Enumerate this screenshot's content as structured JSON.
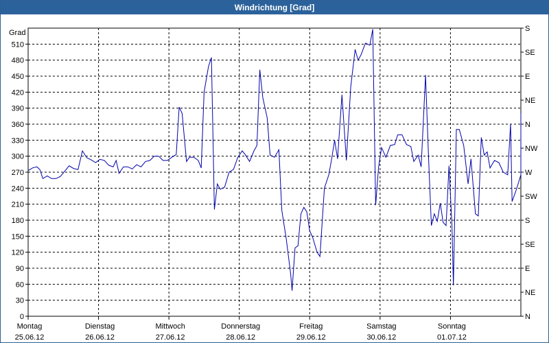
{
  "window": {
    "title": "Windrichtung [Grad]"
  },
  "chart_data": {
    "type": "line",
    "title": "Windrichtung [Grad]",
    "ylabel": "Grad",
    "ylim": [
      0,
      540
    ],
    "yticks": [
      0,
      30,
      60,
      90,
      120,
      150,
      180,
      210,
      240,
      270,
      300,
      330,
      360,
      390,
      420,
      450,
      480,
      510
    ],
    "right_axis": {
      "labels": [
        "N",
        "NE",
        "E",
        "SE",
        "S",
        "SW",
        "W",
        "NW",
        "N",
        "NE",
        "E",
        "SE",
        "S"
      ],
      "values": [
        0,
        45,
        90,
        135,
        180,
        225,
        270,
        315,
        360,
        405,
        450,
        495,
        540
      ]
    },
    "xlim": [
      "2012-06-25T00:00",
      "2012-07-02T00:00"
    ],
    "xticks": [
      {
        "day": "Montag",
        "date": "25.06.12",
        "x": "2012-06-25T00:00"
      },
      {
        "day": "Dienstag",
        "date": "26.06.12",
        "x": "2012-06-26T00:00"
      },
      {
        "day": "Mittwoch",
        "date": "27.06.12",
        "x": "2012-06-27T00:00"
      },
      {
        "day": "Donnerstag",
        "date": "28.06.12",
        "x": "2012-06-28T00:00"
      },
      {
        "day": "Freitag",
        "date": "29.06.12",
        "x": "2012-06-29T00:00"
      },
      {
        "day": "Samstag",
        "date": "30.06.12",
        "x": "2012-06-30T00:00"
      },
      {
        "day": "Sonntag",
        "date": "01.07.12",
        "x": "2012-07-01T00:00"
      }
    ],
    "grid": true,
    "line_color": "#0000aa",
    "series": [
      {
        "points": [
          [
            "2012-06-25T00:00",
            273
          ],
          [
            "2012-06-25T01:30",
            278
          ],
          [
            "2012-06-25T03:00",
            280
          ],
          [
            "2012-06-25T04:00",
            275
          ],
          [
            "2012-06-25T05:00",
            258
          ],
          [
            "2012-06-25T06:30",
            263
          ],
          [
            "2012-06-25T08:00",
            258
          ],
          [
            "2012-06-25T09:30",
            258
          ],
          [
            "2012-06-25T11:00",
            262
          ],
          [
            "2012-06-25T12:30",
            272
          ],
          [
            "2012-06-25T14:00",
            282
          ],
          [
            "2012-06-25T15:30",
            277
          ],
          [
            "2012-06-25T17:00",
            275
          ],
          [
            "2012-06-25T18:30",
            310
          ],
          [
            "2012-06-25T20:00",
            297
          ],
          [
            "2012-06-25T21:30",
            293
          ],
          [
            "2012-06-25T23:00",
            288
          ],
          [
            "2012-06-26T00:30",
            294
          ],
          [
            "2012-06-26T02:00",
            292
          ],
          [
            "2012-06-26T03:30",
            283
          ],
          [
            "2012-06-26T05:00",
            280
          ],
          [
            "2012-06-26T06:00",
            292
          ],
          [
            "2012-06-26T07:00",
            268
          ],
          [
            "2012-06-26T08:30",
            280
          ],
          [
            "2012-06-26T10:00",
            280
          ],
          [
            "2012-06-26T11:30",
            276
          ],
          [
            "2012-06-26T13:00",
            284
          ],
          [
            "2012-06-26T14:30",
            280
          ],
          [
            "2012-06-26T16:00",
            290
          ],
          [
            "2012-06-26T17:30",
            292
          ],
          [
            "2012-06-26T19:00",
            300
          ],
          [
            "2012-06-26T20:30",
            300
          ],
          [
            "2012-06-26T22:00",
            292
          ],
          [
            "2012-06-26T23:30",
            292
          ],
          [
            "2012-06-27T01:00",
            298
          ],
          [
            "2012-06-27T02:30",
            303
          ],
          [
            "2012-06-27T03:30",
            392
          ],
          [
            "2012-06-27T04:30",
            380
          ],
          [
            "2012-06-27T06:00",
            290
          ],
          [
            "2012-06-27T07:00",
            298
          ],
          [
            "2012-06-27T08:30",
            298
          ],
          [
            "2012-06-27T10:00",
            292
          ],
          [
            "2012-06-27T11:00",
            278
          ],
          [
            "2012-06-27T12:00",
            420
          ],
          [
            "2012-06-27T13:30",
            468
          ],
          [
            "2012-06-27T14:30",
            485
          ],
          [
            "2012-06-27T15:30",
            200
          ],
          [
            "2012-06-27T16:30",
            248
          ],
          [
            "2012-06-27T17:30",
            238
          ],
          [
            "2012-06-27T19:00",
            242
          ],
          [
            "2012-06-27T20:30",
            270
          ],
          [
            "2012-06-27T22:00",
            275
          ],
          [
            "2012-06-27T23:30",
            298
          ],
          [
            "2012-06-28T01:00",
            310
          ],
          [
            "2012-06-28T02:00",
            303
          ],
          [
            "2012-06-28T03:30",
            290
          ],
          [
            "2012-06-28T05:00",
            310
          ],
          [
            "2012-06-28T06:00",
            320
          ],
          [
            "2012-06-28T07:00",
            462
          ],
          [
            "2012-06-28T08:00",
            410
          ],
          [
            "2012-06-28T09:30",
            372
          ],
          [
            "2012-06-28T10:30",
            302
          ],
          [
            "2012-06-28T12:00",
            298
          ],
          [
            "2012-06-28T13:30",
            312
          ],
          [
            "2012-06-28T14:30",
            198
          ],
          [
            "2012-06-28T16:00",
            145
          ],
          [
            "2012-06-28T17:30",
            80
          ],
          [
            "2012-06-28T18:00",
            48
          ],
          [
            "2012-06-28T19:00",
            128
          ],
          [
            "2012-06-28T20:00",
            132
          ],
          [
            "2012-06-28T21:00",
            192
          ],
          [
            "2012-06-28T22:00",
            204
          ],
          [
            "2012-06-28T23:00",
            196
          ],
          [
            "2012-06-29T00:00",
            160
          ],
          [
            "2012-06-29T01:00",
            148
          ],
          [
            "2012-06-29T02:30",
            120
          ],
          [
            "2012-06-29T03:30",
            112
          ],
          [
            "2012-06-29T05:00",
            240
          ],
          [
            "2012-06-29T06:30",
            265
          ],
          [
            "2012-06-29T07:30",
            295
          ],
          [
            "2012-06-29T08:30",
            330
          ],
          [
            "2012-06-29T09:30",
            295
          ],
          [
            "2012-06-29T11:00",
            415
          ],
          [
            "2012-06-29T12:30",
            292
          ],
          [
            "2012-06-29T14:00",
            430
          ],
          [
            "2012-06-29T15:30",
            500
          ],
          [
            "2012-06-29T16:30",
            480
          ],
          [
            "2012-06-29T17:30",
            490
          ],
          [
            "2012-06-29T19:00",
            512
          ],
          [
            "2012-06-29T20:30",
            508
          ],
          [
            "2012-06-29T21:30",
            538
          ],
          [
            "2012-06-29T22:30",
            208
          ],
          [
            "2012-06-29T23:30",
            280
          ],
          [
            "2012-06-30T00:30",
            316
          ],
          [
            "2012-06-30T02:00",
            298
          ],
          [
            "2012-06-30T03:30",
            320
          ],
          [
            "2012-06-30T05:00",
            322
          ],
          [
            "2012-06-30T06:00",
            340
          ],
          [
            "2012-06-30T07:30",
            340
          ],
          [
            "2012-06-30T09:00",
            322
          ],
          [
            "2012-06-30T10:30",
            318
          ],
          [
            "2012-06-30T11:30",
            290
          ],
          [
            "2012-06-30T13:00",
            302
          ],
          [
            "2012-06-30T14:00",
            280
          ],
          [
            "2012-06-30T15:30",
            452
          ],
          [
            "2012-06-30T16:30",
            300
          ],
          [
            "2012-06-30T17:30",
            170
          ],
          [
            "2012-06-30T18:30",
            192
          ],
          [
            "2012-06-30T19:30",
            178
          ],
          [
            "2012-06-30T20:30",
            212
          ],
          [
            "2012-06-30T21:30",
            176
          ],
          [
            "2012-06-30T22:30",
            170
          ],
          [
            "2012-06-30T23:30",
            282
          ],
          [
            "2012-07-01T00:30",
            170
          ],
          [
            "2012-07-01T01:00",
            58
          ],
          [
            "2012-07-01T02:00",
            350
          ],
          [
            "2012-07-01T03:00",
            350
          ],
          [
            "2012-07-01T04:30",
            320
          ],
          [
            "2012-07-01T06:00",
            248
          ],
          [
            "2012-07-01T07:00",
            295
          ],
          [
            "2012-07-01T08:30",
            192
          ],
          [
            "2012-07-01T09:30",
            188
          ],
          [
            "2012-07-01T10:30",
            335
          ],
          [
            "2012-07-01T11:30",
            302
          ],
          [
            "2012-07-01T12:30",
            308
          ],
          [
            "2012-07-01T13:30",
            278
          ],
          [
            "2012-07-01T15:00",
            292
          ],
          [
            "2012-07-01T16:30",
            288
          ],
          [
            "2012-07-01T18:00",
            270
          ],
          [
            "2012-07-01T19:30",
            265
          ],
          [
            "2012-07-01T20:30",
            360
          ],
          [
            "2012-07-01T21:00",
            215
          ],
          [
            "2012-07-01T22:30",
            238
          ],
          [
            "2012-07-02T00:00",
            265
          ],
          [
            "2012-07-02T01:30",
            300
          ],
          [
            "2012-07-02T02:30",
            300
          ],
          [
            "2012-07-02T03:30",
            368
          ],
          [
            "2012-07-02T04:30",
            290
          ],
          [
            "2012-07-02T05:30",
            380
          ],
          [
            "2012-07-02T06:30",
            290
          ]
        ]
      }
    ]
  }
}
